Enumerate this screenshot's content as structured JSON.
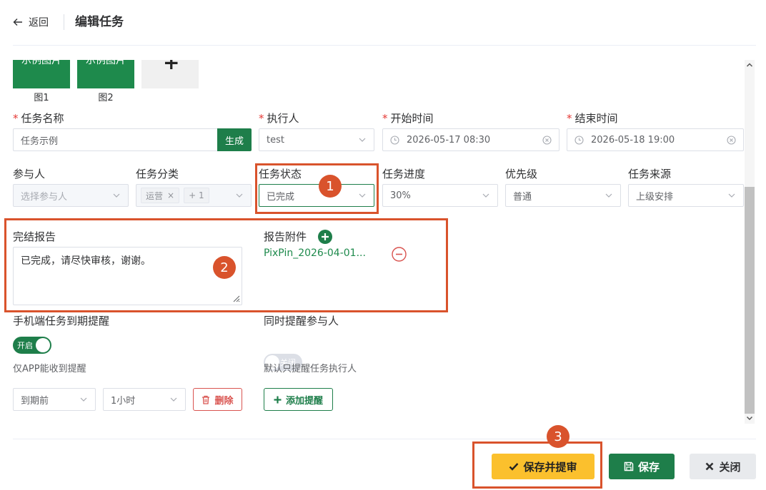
{
  "header": {
    "back_label": "返回",
    "title": "编辑任务"
  },
  "images": {
    "items": [
      {
        "thumb_text": "示例图片",
        "caption": "图1"
      },
      {
        "thumb_text": "示例图片",
        "caption": "图2"
      }
    ],
    "add_symbol": "+"
  },
  "form": {
    "required_mark": "*",
    "task_name": {
      "label": "任务名称",
      "value": "任务示例",
      "generate_label": "生成"
    },
    "executor": {
      "label": "执行人",
      "value": "test"
    },
    "start_time": {
      "label": "开始时间",
      "value": "2026-05-17 08:30"
    },
    "end_time": {
      "label": "结束时间",
      "value": "2026-05-18 19:00"
    },
    "participants": {
      "label": "参与人",
      "placeholder": "选择参与人"
    },
    "category": {
      "label": "任务分类",
      "tag": "运营",
      "more": "+ 1"
    },
    "status": {
      "label": "任务状态",
      "value": "已完成"
    },
    "progress": {
      "label": "任务进度",
      "value": "30%"
    },
    "priority": {
      "label": "优先级",
      "value": "普通"
    },
    "source": {
      "label": "任务来源",
      "value": "上级安排"
    },
    "report": {
      "label": "完结报告",
      "value": "已完成，请尽快审核，谢谢。"
    },
    "attachment": {
      "label": "报告附件",
      "file": "PixPin_2026-04-01..."
    },
    "mobile_reminder": {
      "label": "手机端任务到期提醒",
      "switch_text": "开启",
      "enabled": true,
      "hint": "仅APP能收到提醒"
    },
    "notify_participants": {
      "label": "同时提醒参与人",
      "switch_text": "关闭",
      "enabled": false,
      "hint": "默认只提醒任务执行人"
    },
    "reminder_when": {
      "value": "到期前"
    },
    "reminder_offset": {
      "value": "1小时"
    },
    "delete_label": "删除",
    "add_reminder_label": "添加提醒"
  },
  "annotations": {
    "badge1": "1",
    "badge2": "2",
    "badge3": "3",
    "color": "#d9532c"
  },
  "footer": {
    "save_submit_label": "保存并提审",
    "save_label": "保存",
    "close_label": "关闭"
  },
  "colors": {
    "primary_green": "#1e7e4a",
    "warning_yellow": "#fbc02d",
    "danger_red": "#d9534f"
  }
}
